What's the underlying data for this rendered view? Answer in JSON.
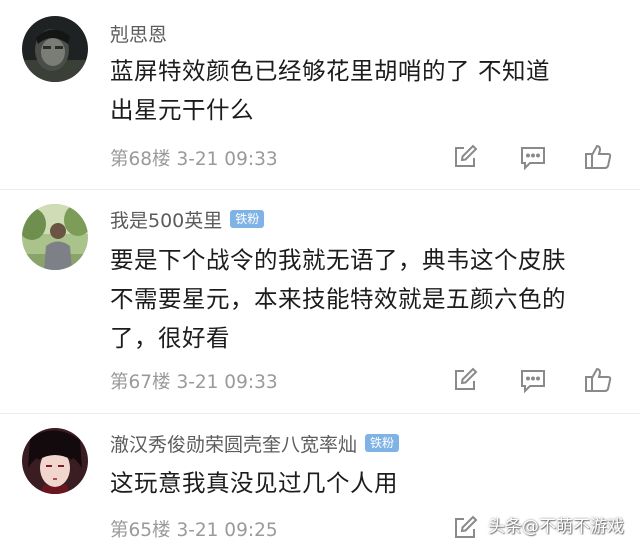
{
  "comments": [
    {
      "username": "剋思恩",
      "badge": "",
      "lines": [
        "蓝屏特效颜色已经够花里胡哨的了 不知道",
        "出星元干什么"
      ],
      "floor": "第68楼",
      "time": "3-21 09:33",
      "avatar_icon": "dark-portrait-avatar"
    },
    {
      "username": "我是500英里",
      "badge": "铁粉",
      "lines": [
        "要是下个战令的我就无语了，典韦这个皮肤",
        "不需要星元，本来技能特效就是五颜六色的",
        "了，很好看"
      ],
      "floor": "第67楼",
      "time": "3-21 09:33",
      "avatar_icon": "man-in-park-avatar"
    },
    {
      "username": "澈汉秀俊勋荣圆壳奎八宽率灿",
      "badge": "铁粉",
      "lines": [
        "这玩意我真没见过几个人用"
      ],
      "floor": "第65楼",
      "time": "3-21 09:25",
      "avatar_icon": "anime-character-avatar"
    }
  ],
  "actions": {
    "edit_icon": "edit-icon",
    "reply_icon": "reply-comment-icon",
    "like_icon": "thumbs-up-icon"
  },
  "watermark": "头条@不萌不游戏",
  "colors": {
    "badge": "#7fb3e6",
    "username": "#5c5c5c",
    "text": "#1c1c1c",
    "meta": "#9a9a9a",
    "divider": "#ececec"
  }
}
